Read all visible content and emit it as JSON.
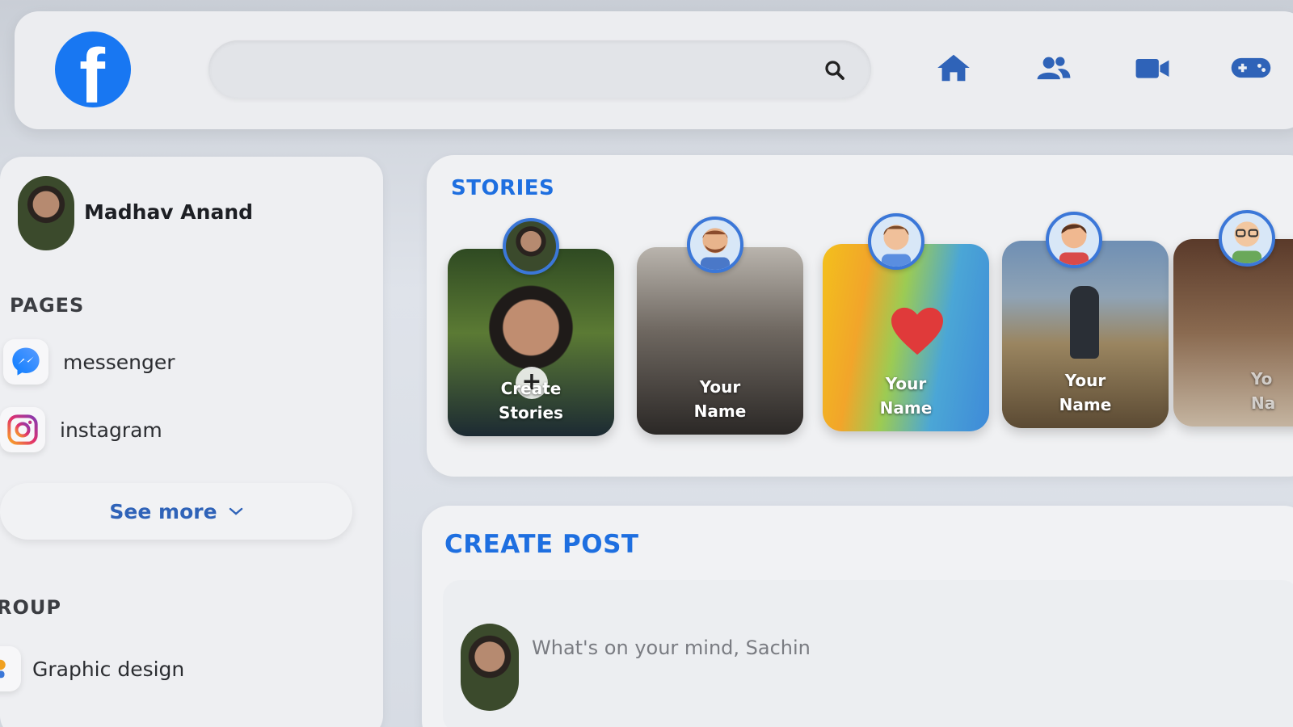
{
  "header": {
    "logo_letter": "f",
    "search": {
      "placeholder": ""
    },
    "nav": [
      "home-icon",
      "friends-icon",
      "video-icon",
      "gaming-icon"
    ]
  },
  "sidebar": {
    "profile_name": "Madhav Anand",
    "pages_label": "PAGES",
    "pages": [
      {
        "label": "messenger",
        "icon": "messenger-icon"
      },
      {
        "label": "instagram",
        "icon": "instagram-icon"
      }
    ],
    "see_more": "See more",
    "group_label": "ROUP",
    "groups": [
      {
        "label": "Graphic design",
        "icon": "group-icon"
      }
    ]
  },
  "stories": {
    "title": "STORIES",
    "items": [
      {
        "line1": "Create",
        "line2": "Stories"
      },
      {
        "line1": "Your",
        "line2": "Name"
      },
      {
        "line1": "Your",
        "line2": "Name"
      },
      {
        "line1": "Your",
        "line2": "Name"
      },
      {
        "line1": "Yo",
        "line2": "Na"
      }
    ]
  },
  "create_post": {
    "title": "CREATE POST",
    "placeholder": "What's on your mind, Sachin"
  },
  "colors": {
    "accent": "#1e6fe0",
    "facebook": "#1877f2"
  }
}
